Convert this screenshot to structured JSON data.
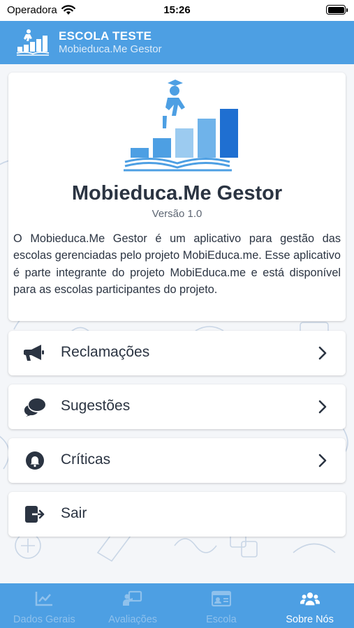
{
  "status_bar": {
    "carrier": "Operadora",
    "time": "15:26"
  },
  "header": {
    "title": "ESCOLA TESTE",
    "subtitle": "Mobieduca.Me Gestor",
    "logo_icon": "school-progress-logo-icon"
  },
  "about": {
    "app_name": "Mobieduca.Me Gestor",
    "version": "Versão 1.0",
    "description": "O Mobieduca.Me Gestor é um aplicativo para gestão das escolas gerenciadas pelo projeto MobiEduca.me. Esse aplicativo é parte integrante do projeto MobiEduca.me e está disponível para as escolas participantes do projeto."
  },
  "menu": [
    {
      "label": "Reclamações",
      "icon": "megaphone-icon",
      "has_chevron": true
    },
    {
      "label": "Sugestões",
      "icon": "chat-bubbles-icon",
      "has_chevron": true
    },
    {
      "label": "Críticas",
      "icon": "bell-icon",
      "has_chevron": true
    },
    {
      "label": "Sair",
      "icon": "sign-out-icon",
      "has_chevron": false
    }
  ],
  "tabs": [
    {
      "label": "Dados Gerais",
      "icon": "chart-line-icon",
      "active": false
    },
    {
      "label": "Avaliações",
      "icon": "teacher-board-icon",
      "active": false
    },
    {
      "label": "Escola",
      "icon": "id-card-icon",
      "active": false
    },
    {
      "label": "Sobre Nós",
      "icon": "users-icon",
      "active": true
    }
  ],
  "colors": {
    "brand_blue": "#4d9fe3",
    "text_dark": "#2b3442",
    "tab_inactive": "#8fc1ec",
    "tab_active": "#ffffff"
  }
}
